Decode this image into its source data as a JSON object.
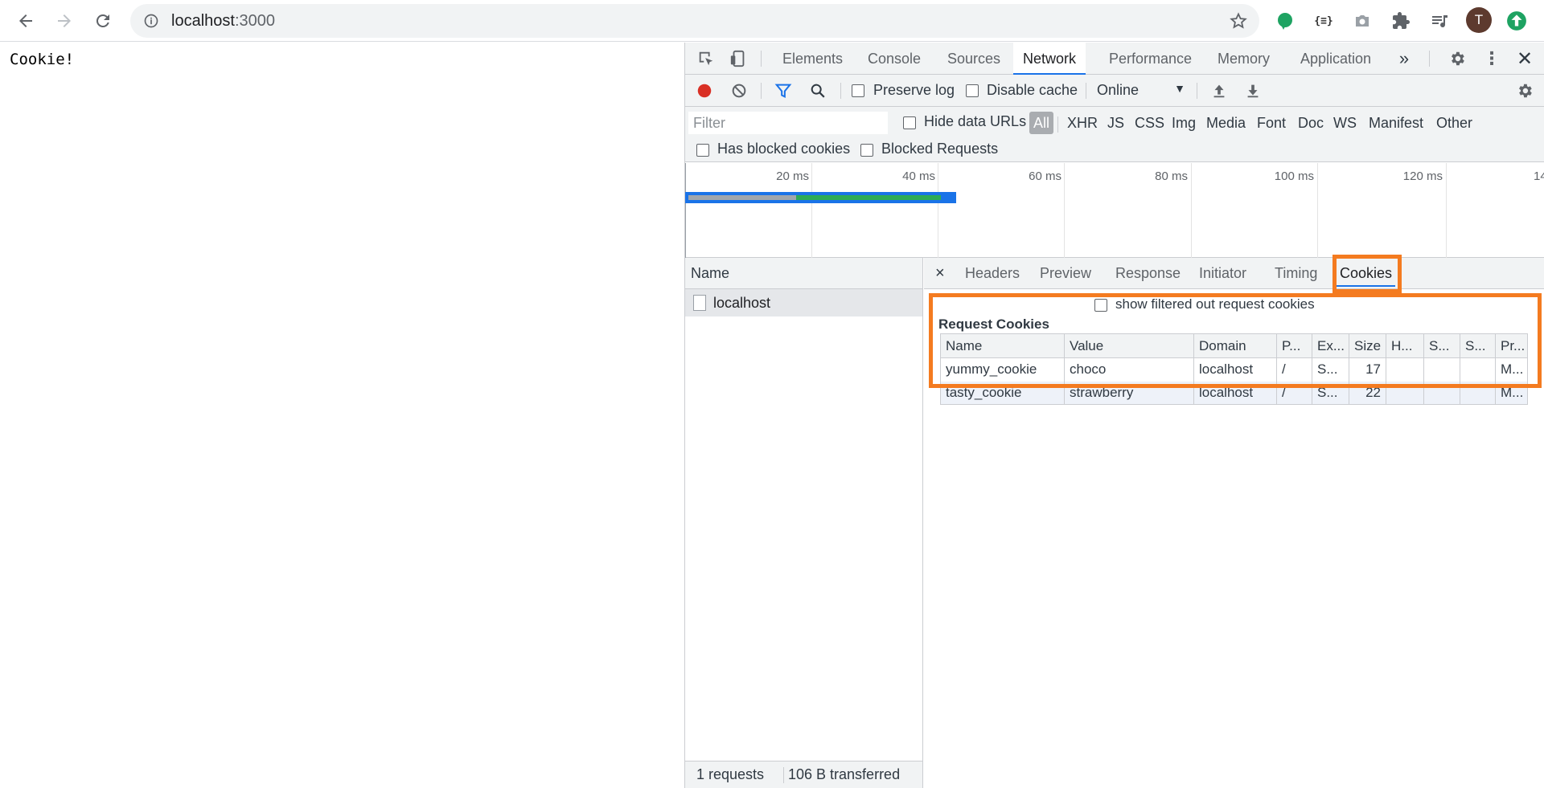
{
  "browser": {
    "url_host": "localhost",
    "url_port": ":3000",
    "avatar_letter": "T"
  },
  "page": {
    "text": "Cookie!"
  },
  "devtools": {
    "tabs": [
      "Elements",
      "Console",
      "Sources",
      "Network",
      "Performance",
      "Memory",
      "Application"
    ],
    "active_tab": "Network",
    "toolbar": {
      "preserve_log": "Preserve log",
      "disable_cache": "Disable cache",
      "throttle": "Online"
    },
    "filter": {
      "placeholder": "Filter",
      "hide_data_urls": "Hide data URLs",
      "types": [
        "All",
        "XHR",
        "JS",
        "CSS",
        "Img",
        "Media",
        "Font",
        "Doc",
        "WS",
        "Manifest",
        "Other"
      ],
      "has_blocked_cookies": "Has blocked cookies",
      "blocked_requests": "Blocked Requests"
    },
    "overview": {
      "ticks": [
        "20 ms",
        "40 ms",
        "60 ms",
        "80 ms",
        "100 ms",
        "120 ms",
        "14"
      ]
    },
    "request_list": {
      "header": "Name",
      "requests": [
        "localhost"
      ],
      "status_requests": "1 requests",
      "status_transferred": "106 B transferred"
    },
    "detail": {
      "close": "×",
      "tabs": [
        "Headers",
        "Preview",
        "Response",
        "Initiator",
        "Timing",
        "Cookies"
      ],
      "active_tab": "Cookies",
      "section_title": "Request Cookies",
      "show_filtered": "show filtered out request cookies",
      "columns": [
        "Name",
        "Value",
        "Domain",
        "P...",
        "Ex...",
        "Size",
        "H...",
        "S...",
        "S...",
        "Pr..."
      ],
      "rows": [
        [
          "yummy_cookie",
          "choco",
          "localhost",
          "/",
          "S...",
          "17",
          "",
          "",
          "",
          "M..."
        ],
        [
          "tasty_cookie",
          "strawberry",
          "localhost",
          "/",
          "S...",
          "22",
          "",
          "",
          "",
          "M..."
        ]
      ]
    }
  },
  "colors": {
    "highlight": "#f47b20",
    "accent": "#1a73e8",
    "record": "#d93025"
  }
}
